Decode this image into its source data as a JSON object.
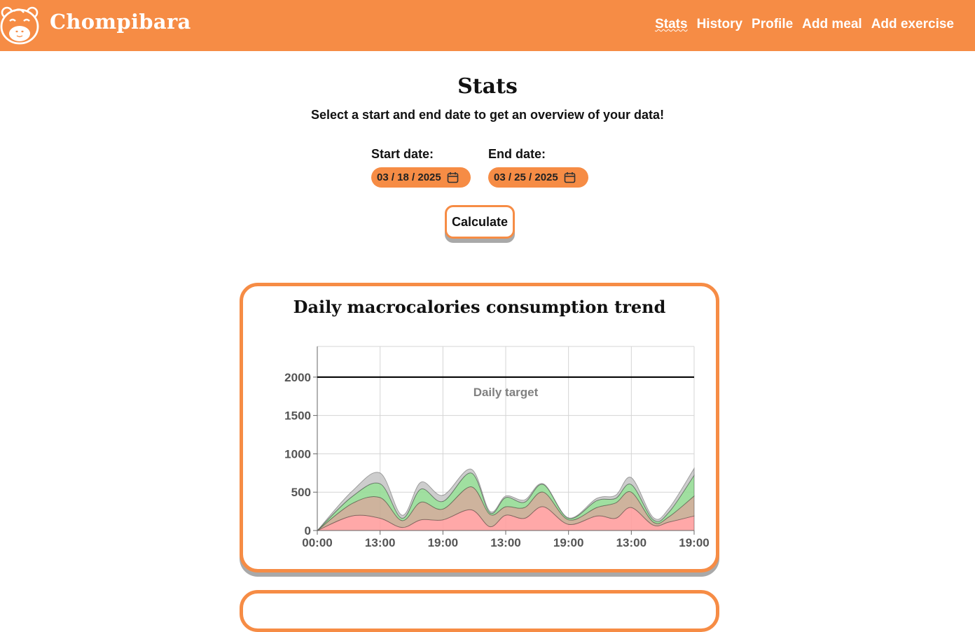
{
  "app": {
    "name": "Chompibara",
    "accent_color": "#f68c45",
    "logo_icon": "capybara-logo-icon"
  },
  "nav": {
    "links": [
      {
        "label": "Stats",
        "active": true
      },
      {
        "label": "History",
        "active": false
      },
      {
        "label": "Profile",
        "active": false
      },
      {
        "label": "Add meal",
        "active": false
      },
      {
        "label": "Add exercise",
        "active": false
      }
    ]
  },
  "page": {
    "title": "Stats",
    "subtitle": "Select a start and end date to get an overview of your data!"
  },
  "form": {
    "start_label": "Start date:",
    "start_value": "03 / 18 / 2025",
    "end_label": "End date:",
    "end_value": "03 / 25 / 2025",
    "calendar_icon": "calendar-icon",
    "calculate_label": "Calculate"
  },
  "card": {
    "title": "Daily macrocalories consumption trend"
  },
  "chart_data": {
    "type": "area",
    "stacked": true,
    "x_ticks": [
      "00:00",
      "13:00",
      "19:00",
      "13:00",
      "19:00",
      "13:00",
      "19:00"
    ],
    "x": [
      0,
      0.55,
      1,
      1.35,
      1.65,
      2,
      2.45,
      2.75,
      3,
      3.3,
      3.6,
      4,
      4.45,
      4.75,
      5,
      5.35,
      5.6,
      6
    ],
    "series": [
      {
        "color": "#ff9e9e",
        "values": [
          0,
          190,
          160,
          40,
          140,
          140,
          270,
          50,
          200,
          160,
          310,
          80,
          190,
          160,
          300,
          70,
          110,
          190
        ]
      },
      {
        "color": "#c9ab92",
        "values": [
          0,
          160,
          270,
          90,
          230,
          140,
          300,
          160,
          110,
          140,
          190,
          60,
          110,
          200,
          200,
          40,
          70,
          260
        ]
      },
      {
        "color": "#96dc96",
        "values": [
          0,
          90,
          180,
          30,
          170,
          100,
          180,
          20,
          120,
          70,
          100,
          20,
          90,
          60,
          100,
          30,
          60,
          270
        ]
      },
      {
        "color": "#c8c8c8",
        "values": [
          0,
          70,
          140,
          40,
          90,
          80,
          50,
          20,
          20,
          30,
          10,
          5,
          30,
          40,
          90,
          30,
          50,
          90
        ]
      }
    ],
    "target": {
      "value": 2000,
      "label": "Daily target",
      "color": "#000000"
    },
    "ylim": [
      0,
      2400
    ],
    "y_ticks": [
      0,
      500,
      1000,
      1500,
      2000
    ],
    "grid": true
  }
}
